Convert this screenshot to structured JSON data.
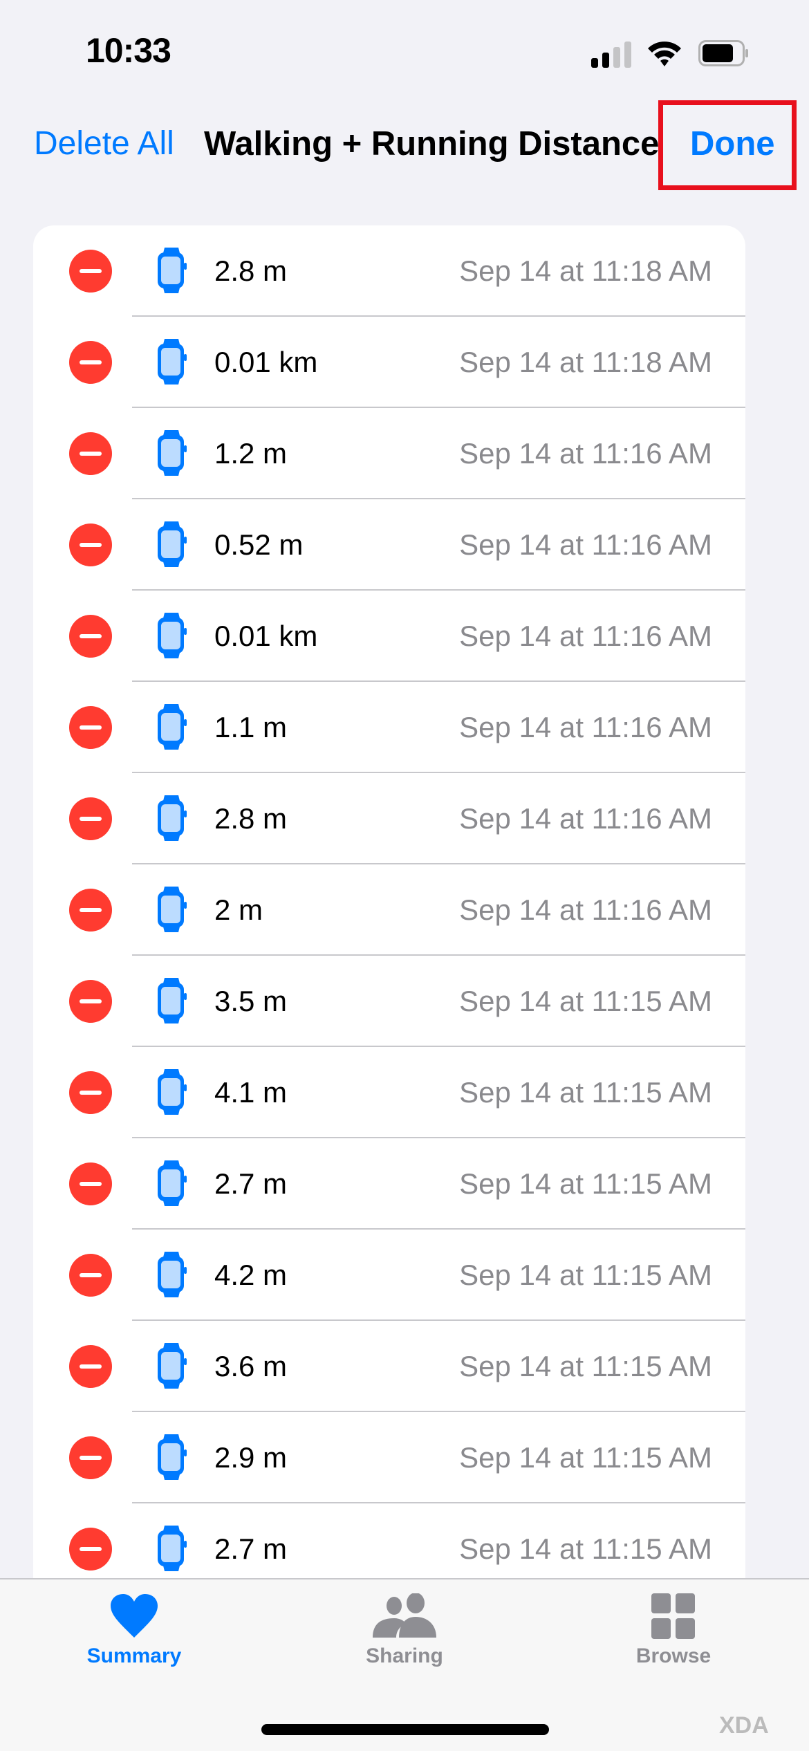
{
  "status_bar": {
    "time": "10:33",
    "signal_bars_filled": 2,
    "signal_bars_total": 4
  },
  "navbar": {
    "left_button": "Delete All",
    "title": "Walking + Running Distance",
    "right_button": "Done"
  },
  "colors": {
    "accent": "#007aff",
    "delete": "#ff3b30",
    "highlight": "#e8101d",
    "secondary_text": "#8a8a8e"
  },
  "samples": [
    {
      "value": "2.8 m",
      "date": "Sep 14 at 11:18 AM",
      "source_icon": "apple-watch-icon"
    },
    {
      "value": "0.01 km",
      "date": "Sep 14 at 11:18 AM",
      "source_icon": "apple-watch-icon"
    },
    {
      "value": "1.2 m",
      "date": "Sep 14 at 11:16 AM",
      "source_icon": "apple-watch-icon"
    },
    {
      "value": "0.52 m",
      "date": "Sep 14 at 11:16 AM",
      "source_icon": "apple-watch-icon"
    },
    {
      "value": "0.01 km",
      "date": "Sep 14 at 11:16 AM",
      "source_icon": "apple-watch-icon"
    },
    {
      "value": "1.1 m",
      "date": "Sep 14 at 11:16 AM",
      "source_icon": "apple-watch-icon"
    },
    {
      "value": "2.8 m",
      "date": "Sep 14 at 11:16 AM",
      "source_icon": "apple-watch-icon"
    },
    {
      "value": "2 m",
      "date": "Sep 14 at 11:16 AM",
      "source_icon": "apple-watch-icon"
    },
    {
      "value": "3.5 m",
      "date": "Sep 14 at 11:15 AM",
      "source_icon": "apple-watch-icon"
    },
    {
      "value": "4.1 m",
      "date": "Sep 14 at 11:15 AM",
      "source_icon": "apple-watch-icon"
    },
    {
      "value": "2.7 m",
      "date": "Sep 14 at 11:15 AM",
      "source_icon": "apple-watch-icon"
    },
    {
      "value": "4.2 m",
      "date": "Sep 14 at 11:15 AM",
      "source_icon": "apple-watch-icon"
    },
    {
      "value": "3.6 m",
      "date": "Sep 14 at 11:15 AM",
      "source_icon": "apple-watch-icon"
    },
    {
      "value": "2.9 m",
      "date": "Sep 14 at 11:15 AM",
      "source_icon": "apple-watch-icon"
    },
    {
      "value": "2.7 m",
      "date": "Sep 14 at 11:15 AM",
      "source_icon": "apple-watch-icon"
    }
  ],
  "tabbar": {
    "tabs": [
      {
        "label": "Summary",
        "icon": "heart-icon",
        "active": true
      },
      {
        "label": "Sharing",
        "icon": "people-icon",
        "active": false
      },
      {
        "label": "Browse",
        "icon": "grid-icon",
        "active": false
      }
    ]
  },
  "watermark": "XDA"
}
